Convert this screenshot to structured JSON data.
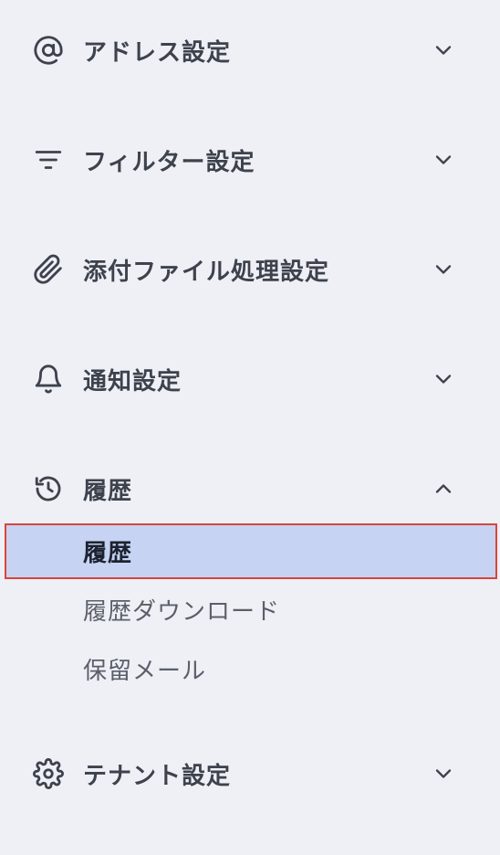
{
  "menu": {
    "address": {
      "label": "アドレス設定",
      "icon": "at-icon"
    },
    "filter": {
      "label": "フィルター設定",
      "icon": "filter-icon"
    },
    "attachment": {
      "label": "添付ファイル処理設定",
      "icon": "paperclip-icon"
    },
    "notification": {
      "label": "通知設定",
      "icon": "bell-icon"
    },
    "history": {
      "label": "履歴",
      "icon": "history-icon",
      "expanded": true,
      "items": [
        {
          "label": "履歴",
          "selected": true
        },
        {
          "label": "履歴ダウンロード",
          "selected": false
        },
        {
          "label": "保留メール",
          "selected": false
        }
      ]
    },
    "tenant": {
      "label": "テナント設定",
      "icon": "gear-icon"
    }
  },
  "colors": {
    "background": "#eef0f5",
    "selected_bg": "#c6d3f2",
    "selected_border": "#d9453b",
    "text": "#3d424d"
  }
}
